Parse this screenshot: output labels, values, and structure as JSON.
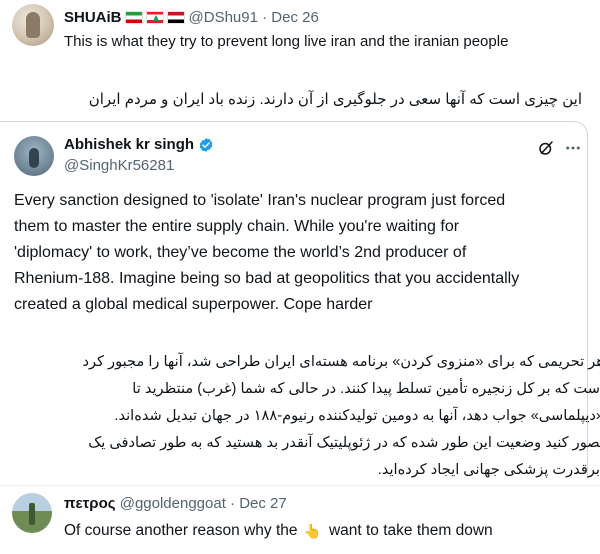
{
  "post_top": {
    "display_name": "SHUAiB",
    "flags": [
      "iran-flag",
      "lebanon-flag",
      "iraq-flag"
    ],
    "handle_date": "@DShu91 · Dec 26",
    "text_en": "This is what they try to prevent long live iran and the iranian people",
    "text_fa": "این چیزی است که آنها سعی در جلوگیری از آن دارند. زنده باد ایران و مردم ایران"
  },
  "quoted_post": {
    "display_name": "Abhishek kr singh",
    "handle": "@SinghKr56281",
    "verified": true,
    "icons": [
      "grok-icon",
      "more-icon"
    ],
    "text_lines": [
      "Every sanction designed to 'isolate' Iran's nuclear program just forced",
      "them to master the entire supply chain. While you're waiting for",
      "'diplomacy' to work, they’ve become the world’s 2nd producer of",
      "Rhenium-188. Imagine being so bad at geopolitics that you accidentally",
      "created a global medical superpower. Cope harder"
    ],
    "translation_lines": [
      "هر تحریمی که برای «منزوی کردن» برنامه هسته‌ای ایران طراحی شد، آنها را مجبور کرد",
      "است که بر کل زنجیره تأمین تسلط پیدا کنند. در حالی که شما (غرب) منتظرید تا",
      "«دیپلماسی» جواب دهد، آنها به دومین تولیدکننده رنیوم-۱۸۸ در جهان تبدیل شده‌اند.",
      "تصور کنید وضعیت این طور شده که در ژئوپلیتیک آنقدر بد هستید که به طور تصادفی یک",
      "ابرقدرت پزشکی جهانی ایجاد کرده‌اید."
    ]
  },
  "post_bottom": {
    "display_name": "πετρος",
    "handle_date": "@ggoldenggoat · Dec 27",
    "text_before": "Of course another reason why the",
    "emoji": "👆",
    "text_after": "want to take them down"
  },
  "colors": {
    "text": "#0f1419",
    "muted": "#536471",
    "verified": "#1d9bf0",
    "border": "#cfd9de"
  }
}
